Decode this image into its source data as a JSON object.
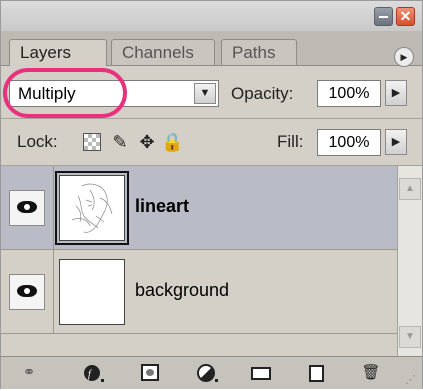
{
  "window": {
    "close_glyph": "✕"
  },
  "tabs": [
    {
      "label": "Layers",
      "active": true
    },
    {
      "label": "Channels",
      "active": false
    },
    {
      "label": "Paths",
      "active": false
    }
  ],
  "panel_menu_glyph": "▶",
  "options": {
    "blend_mode": "Multiply",
    "opacity_label": "Opacity:",
    "opacity_value": "100%",
    "highlight_color": "#e8317d"
  },
  "lock": {
    "label": "Lock:",
    "fill_label": "Fill:",
    "fill_value": "100%"
  },
  "layers": [
    {
      "name": "lineart",
      "visible": true,
      "selected": true,
      "icon": "eye-icon"
    },
    {
      "name": "background",
      "visible": true,
      "selected": false,
      "icon": "eye-icon"
    }
  ],
  "bottom_icons": [
    "link-layers-icon",
    "layer-style-icon",
    "layer-mask-icon",
    "adjustment-layer-icon",
    "new-group-icon",
    "new-layer-icon",
    "trash-icon"
  ],
  "colors": {
    "panel_bg": "#d4d0c8",
    "selected_row": "#b9bbc6",
    "close_button": "#d4502f"
  }
}
